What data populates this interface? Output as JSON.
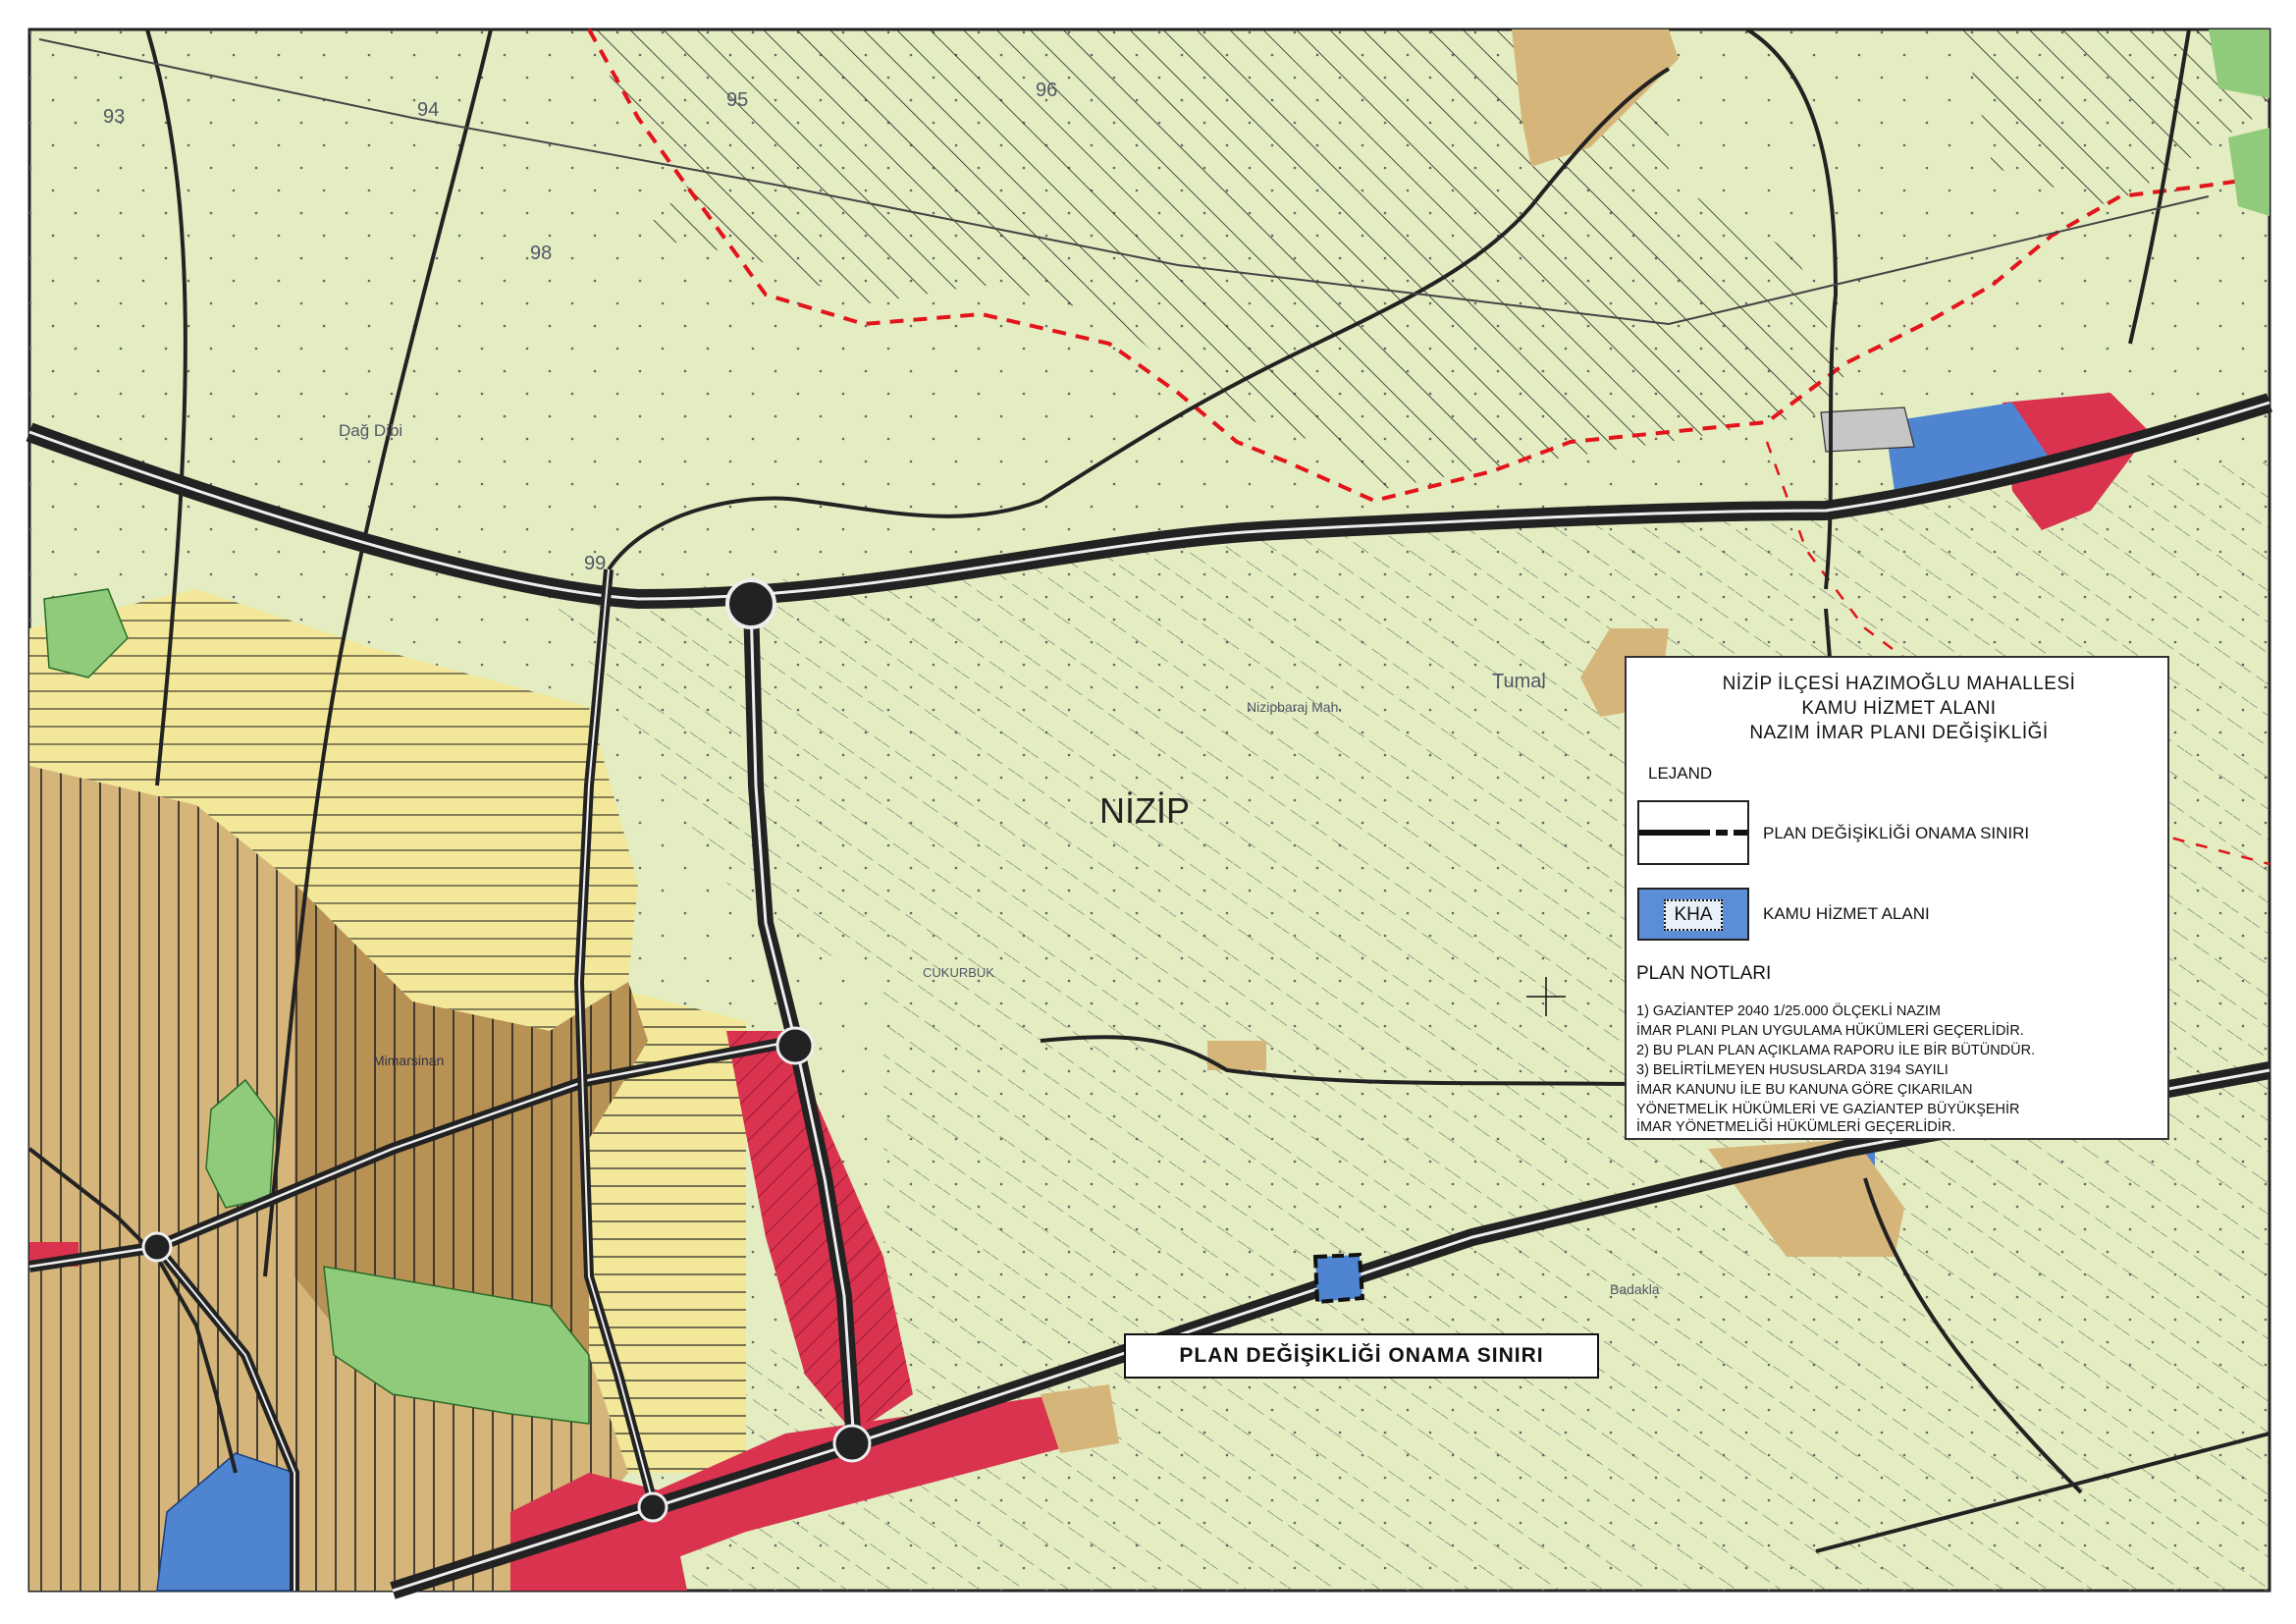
{
  "legend": {
    "title_lines": [
      "NİZİP İLÇESİ HAZIMOĞLU MAHALLESİ",
      "KAMU HİZMET ALANI",
      "NAZIM İMAR PLANI DEĞİŞİKLİĞİ"
    ],
    "lejand_label": "LEJAND",
    "items": [
      {
        "label": "PLAN DEĞİŞİKLİĞİ ONAMA SINIRI",
        "symbol": "boundary-line"
      },
      {
        "label": "KAMU HİZMET ALANI",
        "symbol": "kha-fill",
        "symbol_text": "KHA"
      }
    ],
    "notes_title": "PLAN NOTLARI",
    "notes_lines": [
      "1)  GAZİANTEP 2040 1/25.000 ÖLÇEKLİ NAZIM",
      "İMAR PLANI PLAN UYGULAMA HÜKÜMLERİ GEÇERLİDİR.",
      "2)  BU PLAN PLAN AÇIKLAMA RAPORU İLE BİR BÜTÜNDÜR.",
      "3)  BELİRTİLMEYEN HUSUSLARDA 3194 SAYILI",
      "İMAR KANUNU İLE BU KANUNA GÖRE ÇIKARILAN",
      "YÖNETMELİK HÜKÜMLERİ VE GAZİANTEP BÜYÜKŞEHİR",
      " İMAR YÖNETMELİĞİ HÜKÜMLERİ GEÇERLİDİR."
    ]
  },
  "callout_label": "PLAN DEĞİŞİKLİĞİ ONAMA SINIRI",
  "map_labels": {
    "district": "NİZİP",
    "contour_93": "93",
    "contour_94": "94",
    "contour_95": "95",
    "contour_96": "96",
    "contour_98": "98",
    "contour_99": "99",
    "place_dagdibi": "Dağ Dibi",
    "place_tumal": "Tumal",
    "place_cukurbuk": "CUKURBUK",
    "place_badakla": "Badakla",
    "place_mimar": "Mimarsinan",
    "place_nizip_barak": "Nizipbaraj Mah."
  },
  "colors": {
    "base_agri": "#e3edc1",
    "residential_tan": "#d6b57a",
    "residential_dark": "#b89155",
    "yellow_zone": "#f3e899",
    "green_park": "#8fcb7a",
    "red_commercial": "#d9334f",
    "blue_public": "#4f84d1",
    "grey_area": "#c6c6c6",
    "boundary_red": "#e3141c"
  }
}
